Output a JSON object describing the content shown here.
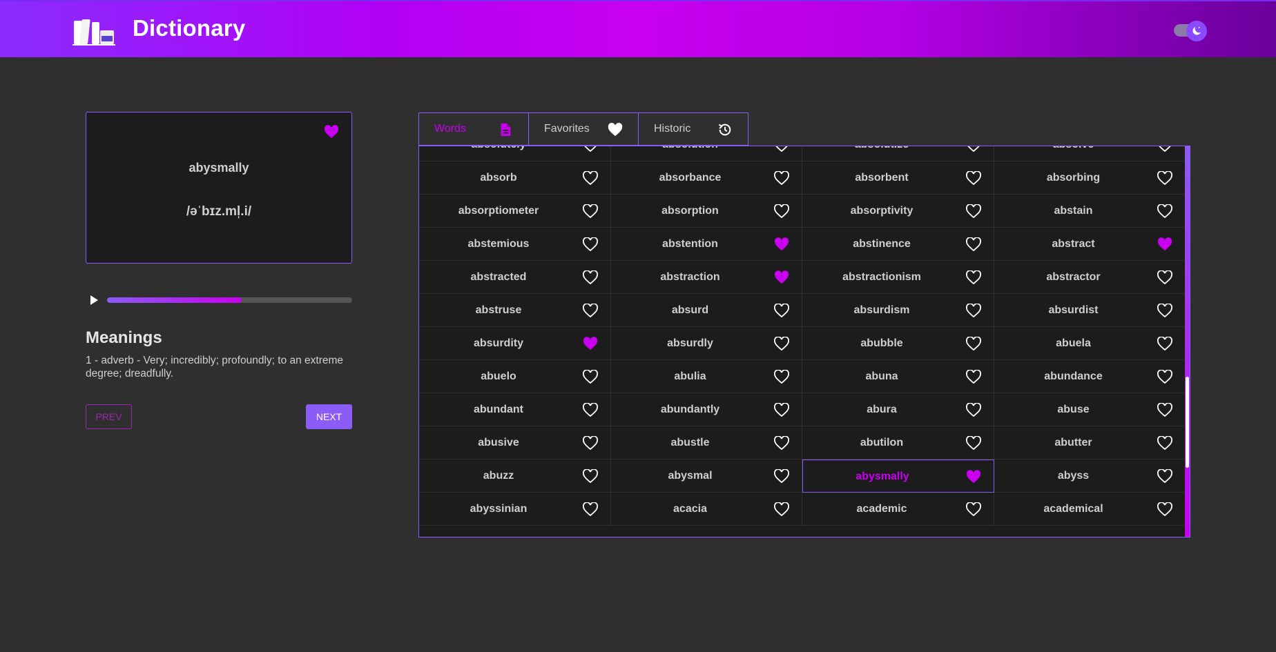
{
  "header": {
    "title": "Dictionary"
  },
  "card": {
    "word": "abysmally",
    "phonetic": "/əˈbɪz.ml̩.i/",
    "favorited": true
  },
  "player": {
    "progress_percent": 55
  },
  "meanings": {
    "title": "Meanings",
    "text": "1 - adverb - Very; incredibly; profoundly; to an extreme degree; dreadfully."
  },
  "nav": {
    "prev": "PREV",
    "next": "NEXT"
  },
  "tabs": [
    {
      "label": "Words",
      "icon": "document-icon",
      "active": true
    },
    {
      "label": "Favorites",
      "icon": "heart-icon",
      "active": false
    },
    {
      "label": "Historic",
      "icon": "history-icon",
      "active": false
    }
  ],
  "colors": {
    "accent": "#8b5cf6",
    "magenta": "#c800ef",
    "background": "#2f2f2f",
    "panel": "#1c1c1c"
  },
  "words": [
    [
      "absolutely",
      false
    ],
    [
      "absolution",
      false
    ],
    [
      "absolutize",
      false
    ],
    [
      "absolve",
      false
    ],
    [
      "absorb",
      false
    ],
    [
      "absorbance",
      false
    ],
    [
      "absorbent",
      false
    ],
    [
      "absorbing",
      false
    ],
    [
      "absorptiometer",
      false
    ],
    [
      "absorption",
      false
    ],
    [
      "absorptivity",
      false
    ],
    [
      "abstain",
      false
    ],
    [
      "abstemious",
      false
    ],
    [
      "abstention",
      true
    ],
    [
      "abstinence",
      false
    ],
    [
      "abstract",
      true
    ],
    [
      "abstracted",
      false
    ],
    [
      "abstraction",
      true
    ],
    [
      "abstractionism",
      false
    ],
    [
      "abstractor",
      false
    ],
    [
      "abstruse",
      false
    ],
    [
      "absurd",
      false
    ],
    [
      "absurdism",
      false
    ],
    [
      "absurdist",
      false
    ],
    [
      "absurdity",
      true
    ],
    [
      "absurdly",
      false
    ],
    [
      "abubble",
      false
    ],
    [
      "abuela",
      false
    ],
    [
      "abuelo",
      false
    ],
    [
      "abulia",
      false
    ],
    [
      "abuna",
      false
    ],
    [
      "abundance",
      false
    ],
    [
      "abundant",
      false
    ],
    [
      "abundantly",
      false
    ],
    [
      "abura",
      false
    ],
    [
      "abuse",
      false
    ],
    [
      "abusive",
      false
    ],
    [
      "abustle",
      false
    ],
    [
      "abutilon",
      false
    ],
    [
      "abutter",
      false
    ],
    [
      "abuzz",
      false
    ],
    [
      "abysmal",
      false
    ],
    [
      "abysmally",
      true
    ],
    [
      "abyss",
      false
    ],
    [
      "abyssinian",
      false
    ],
    [
      "acacia",
      false
    ],
    [
      "academic",
      false
    ],
    [
      "academical",
      false
    ]
  ],
  "selected_word": "abysmally"
}
